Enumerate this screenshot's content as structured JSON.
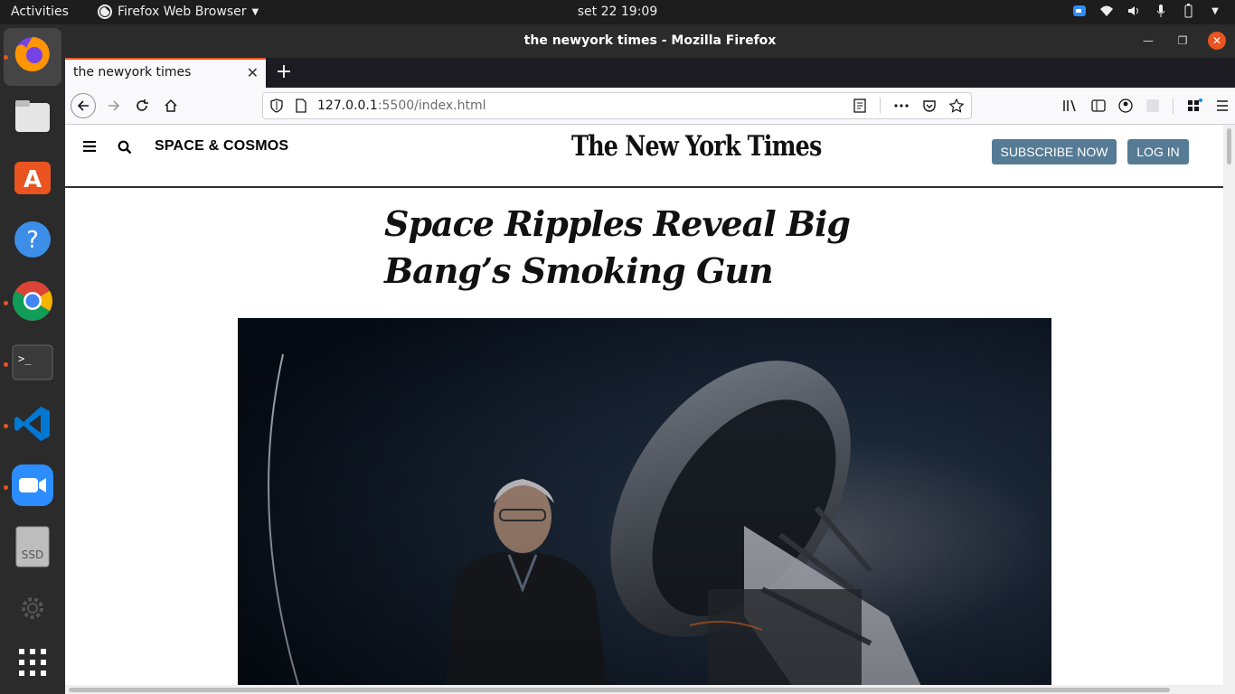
{
  "system": {
    "activities": "Activities",
    "app_menu": "Firefox Web Browser",
    "clock": "set 22  19:09"
  },
  "dock": {
    "items": [
      "firefox",
      "files",
      "software",
      "help",
      "chrome",
      "terminal",
      "vscode",
      "zoom",
      "ssd",
      "show-apps"
    ],
    "ssd_label": "SSD"
  },
  "window": {
    "title": "the newyork times - Mozilla Firefox"
  },
  "tab": {
    "title": "the newyork times"
  },
  "url": {
    "host": "127.0.0.1",
    "rest": ":5500/index.html"
  },
  "page": {
    "section": "SPACE & COSMOS",
    "logo": "The New York Times",
    "subscribe_label": "SUBSCRIBE NOW",
    "login_label": "LOG IN",
    "headline": "Space Ripples Reveal Big Bang’s Smoking Gun"
  },
  "colors": {
    "accent": "#e95420",
    "button": "#567b95",
    "topbar": "#1d1d1d"
  }
}
